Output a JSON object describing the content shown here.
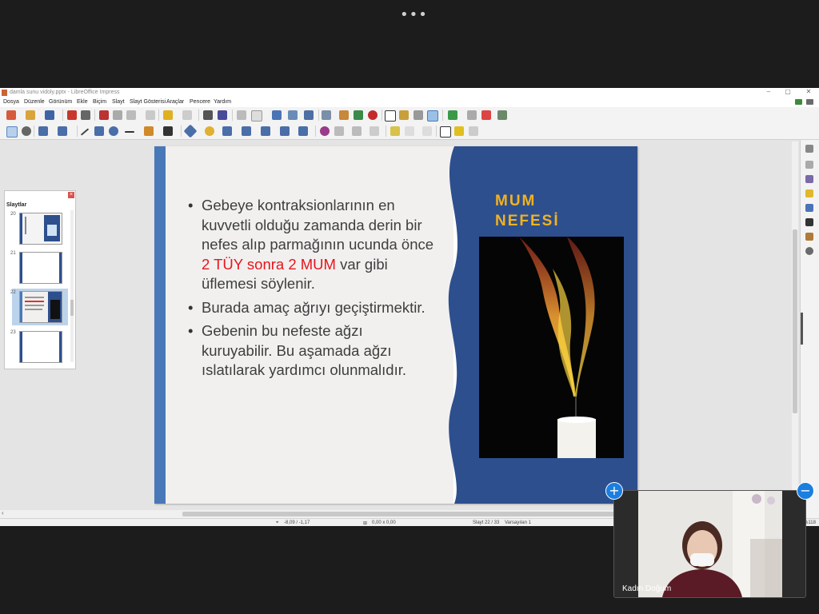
{
  "meeting": {
    "more_dots": "•••",
    "participant_name": "Kadın Doğum"
  },
  "window": {
    "title": "damla sunu vidoly.pptx - LibreOffice Impress"
  },
  "menu": [
    "Dosya",
    "Düzenle",
    "Görünüm",
    "Ekle",
    "Biçim",
    "Slayt",
    "Slayt Gösterisi",
    "Araçlar",
    "Pencere",
    "Yardım"
  ],
  "slides_panel": {
    "title": "Slaytlar",
    "close": "×",
    "numbers": [
      "20",
      "21",
      "22",
      "23"
    ],
    "selected": "22"
  },
  "slide": {
    "bullets": [
      {
        "pre": "Gebeye kontraksionlarının en kuvvetli olduğu zamanda derin bir nefes alıp parmağının ucunda önce ",
        "highlight": "2 TÜY sonra 2 MUM",
        "post": "  var gibi üflemesi söylenir."
      },
      {
        "pre": "Burada amaç ağrıyı geçiştirmektir.",
        "highlight": "",
        "post": ""
      },
      {
        "pre": "Gebenin bu nefeste ağzı kuruyabilir. Bu aşamada ağzı ıslatılarak yardımcı olunmalıdır.",
        "highlight": "",
        "post": ""
      }
    ],
    "title_line1": "MUM",
    "title_line2": "NEFESİ"
  },
  "status": {
    "position": "-8,09 / -1,17",
    "size": "0,00 x 0,00",
    "slide_counter": "Slayt 22 / 33",
    "layout": "Varsayılan 1",
    "zoom": "%118"
  },
  "colors": {
    "accent_blue": "#2d4f8e",
    "title_yellow": "#f2b21e",
    "highlight_red": "#e8141c"
  }
}
